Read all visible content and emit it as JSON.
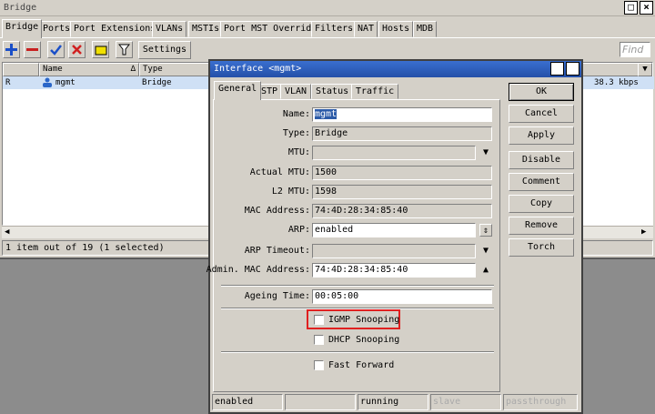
{
  "bridge_window": {
    "title": "Bridge",
    "tabs": [
      "Bridge",
      "Ports",
      "Port Extensions",
      "VLANs",
      "MSTIs",
      "Port MST Overrides",
      "Filters",
      "NAT",
      "Hosts",
      "MDB"
    ],
    "settings_label": "Settings",
    "find_placeholder": "Find",
    "columns": [
      "Name",
      "Type"
    ],
    "row": {
      "flag": "R",
      "name": "mgmt",
      "type": "Bridge",
      "rate": "38.3 kbps"
    },
    "status": "1 item out of 19 (1 selected)"
  },
  "dialog": {
    "title": "Interface <mgmt>",
    "tabs": [
      "General",
      "STP",
      "VLAN",
      "Status",
      "Traffic"
    ],
    "fields": {
      "name": {
        "label": "Name:",
        "value": "mgmt"
      },
      "type": {
        "label": "Type:",
        "value": "Bridge"
      },
      "mtu": {
        "label": "MTU:",
        "value": ""
      },
      "actual_mtu": {
        "label": "Actual MTU:",
        "value": "1500"
      },
      "l2_mtu": {
        "label": "L2 MTU:",
        "value": "1598"
      },
      "mac_address": {
        "label": "MAC Address:",
        "value": "74:4D:28:34:85:40"
      },
      "arp": {
        "label": "ARP:",
        "value": "enabled"
      },
      "arp_timeout": {
        "label": "ARP Timeout:",
        "value": ""
      },
      "admin_mac": {
        "label": "Admin. MAC Address:",
        "value": "74:4D:28:34:85:40"
      },
      "ageing_time": {
        "label": "Ageing Time:",
        "value": "00:05:00"
      }
    },
    "checkboxes": {
      "igmp_snooping": "IGMP Snooping",
      "dhcp_snooping": "DHCP Snooping",
      "fast_forward": "Fast Forward"
    },
    "buttons": {
      "ok": "OK",
      "cancel": "Cancel",
      "apply": "Apply",
      "disable": "Disable",
      "comment": "Comment",
      "copy": "Copy",
      "remove": "Remove",
      "torch": "Torch"
    },
    "status": {
      "state": "enabled",
      "empty": "",
      "running": "running",
      "slave": "slave",
      "passthrough": "passthrough"
    }
  },
  "colors": {
    "accent": "#2c5ba8",
    "highlight": "#e02020",
    "add": "#1a4fc8",
    "remove": "#c82020",
    "enable": "#1a4fc8",
    "disable": "#d02020",
    "comment": "#f0e000"
  }
}
